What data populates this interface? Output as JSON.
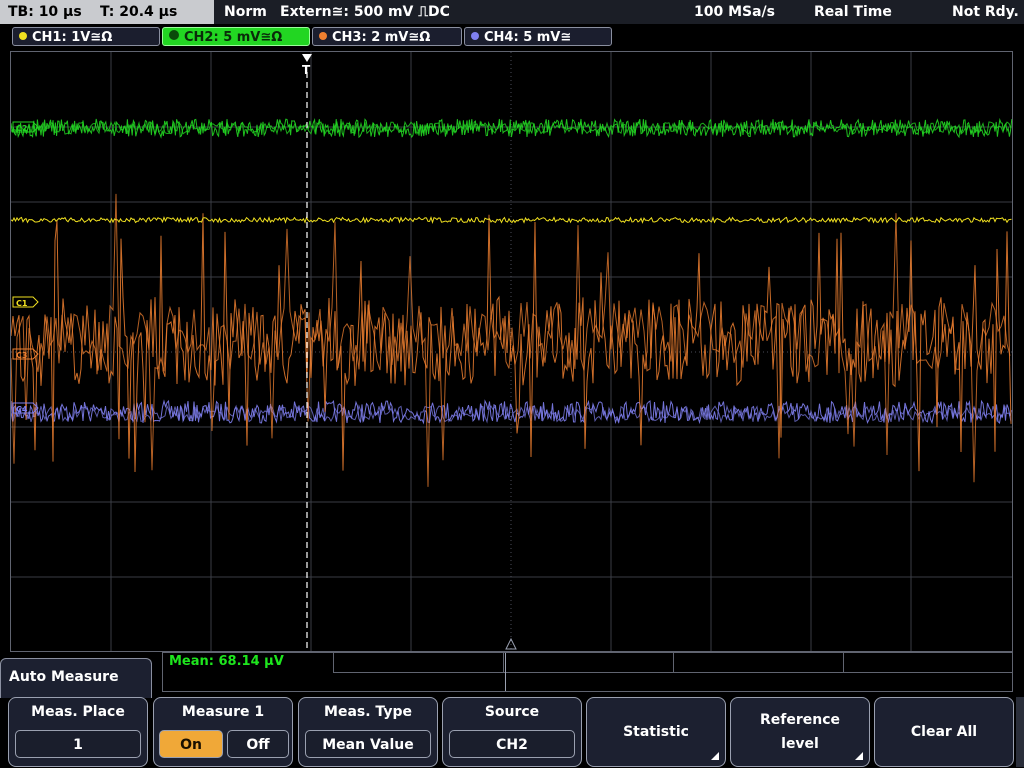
{
  "status": {
    "timebase": "TB: 10 µs",
    "trigger_time": "T: 20.4 µs",
    "mode": "Norm",
    "trigger_source": "Extern≅: 500 mV ⎍DC",
    "sample_rate": "100 MSa/s",
    "acq_mode": "Real Time",
    "state": "Not Rdy."
  },
  "channels": [
    {
      "label": "CH1: 1V≅Ω",
      "color": "#f0e020"
    },
    {
      "label": "CH2: 5 mV≅Ω",
      "color": "#22d622",
      "active": true
    },
    {
      "label": "CH3: 2 mV≅Ω",
      "color": "#f08030"
    },
    {
      "label": "CH4: 5 mV≅",
      "color": "#8080f0"
    }
  ],
  "markers": {
    "c1": "C1",
    "c2": "C2",
    "c3": "C3",
    "c4": "C4",
    "trigger": "T"
  },
  "measurement": {
    "result": "Mean: 68.14 µV"
  },
  "menu": {
    "title": "Auto Measure",
    "meas_place_label": "Meas. Place",
    "meas_place_value": "1",
    "measure1_label": "Measure 1",
    "on_label": "On",
    "off_label": "Off",
    "meas_type_label": "Meas. Type",
    "meas_type_value": "Mean Value",
    "source_label": "Source",
    "source_value": "CH2",
    "statistic_label": "Statistic",
    "reference_label_1": "Reference",
    "reference_label_2": "level",
    "clear_all_label": "Clear All"
  },
  "colors": {
    "ch1": "#f0e020",
    "ch2": "#22d622",
    "ch3": "#f08030",
    "ch4": "#8080f0"
  }
}
